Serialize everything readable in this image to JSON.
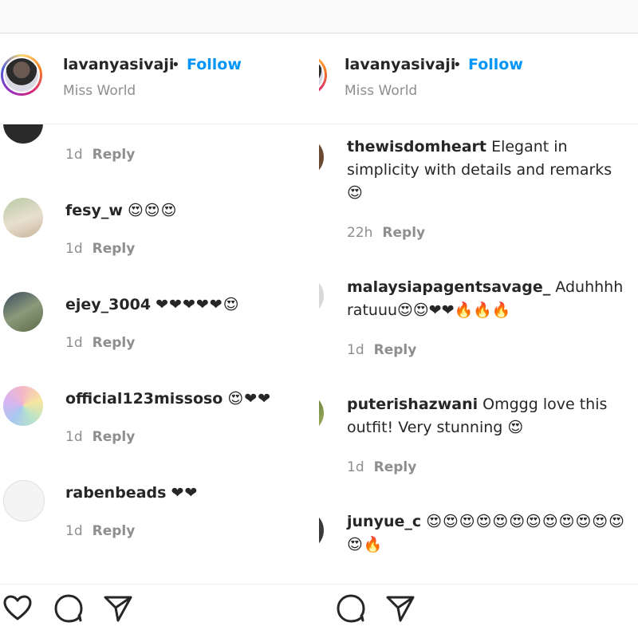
{
  "post_header": {
    "username": "lavanyasivaji",
    "separator": "•",
    "follow_label": "Follow",
    "subtitle": "Miss World"
  },
  "left_comments": [
    {
      "username": "",
      "text": "",
      "time": "1d",
      "reply": "Reply"
    },
    {
      "username": "fesy_w",
      "text": "😍😍😍",
      "time": "1d",
      "reply": "Reply"
    },
    {
      "username": "ejey_3004",
      "text": "❤❤❤❤❤😍",
      "time": "1d",
      "reply": "Reply"
    },
    {
      "username": "official123missoso",
      "text": "😍❤❤",
      "time": "1d",
      "reply": "Reply"
    },
    {
      "username": "rabenbeads",
      "text": "❤❤",
      "time": "1d",
      "reply": "Reply"
    }
  ],
  "right_comments": [
    {
      "username": "thewisdomheart",
      "text": "Elegant in simplicity with details and remarks 😍",
      "time": "22h",
      "reply": "Reply"
    },
    {
      "username": "malaysiapagentsavage_",
      "text": "Aduhhhh ratuuu😍😍❤❤🔥🔥🔥",
      "time": "1d",
      "reply": "Reply"
    },
    {
      "username": "puterishazwani",
      "text": "Omggg love this outfit! Very stunning 😍",
      "time": "1d",
      "reply": "Reply"
    },
    {
      "username": "junyue_c",
      "text": "😍😍😍😍😍😍😍😍😍😍😍😍😍🔥",
      "time": "",
      "reply": ""
    }
  ],
  "icons": [
    "heart-icon",
    "comment-icon",
    "share-icon"
  ],
  "colors": {
    "follow": "#0095f6",
    "muted": "#8e8e8e",
    "text": "#262626"
  }
}
